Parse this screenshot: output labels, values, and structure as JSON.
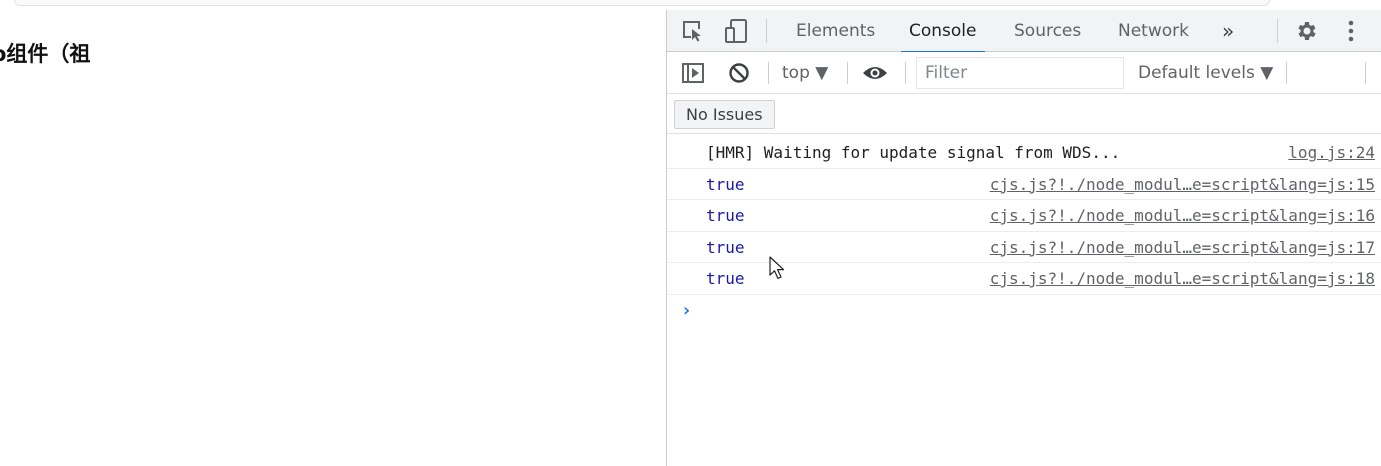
{
  "page": {
    "heading": "o组件（祖"
  },
  "devtools": {
    "tabs": [
      {
        "label": "Elements"
      },
      {
        "label": "Console"
      },
      {
        "label": "Sources"
      },
      {
        "label": "Network"
      }
    ],
    "more_tabs_glyph": "»",
    "toolbar": {
      "context": "top ▼",
      "filter_placeholder": "Filter",
      "levels": "Default levels ▼"
    },
    "issues_label": "No Issues",
    "console": {
      "messages": [
        {
          "text": "[HMR] Waiting for update signal from WDS...",
          "source": "log.js:24"
        },
        {
          "text": "true",
          "source": "cjs.js?!./node_modul…e=script&lang=js:15"
        },
        {
          "text": "true",
          "source": "cjs.js?!./node_modul…e=script&lang=js:16"
        },
        {
          "text": "true",
          "source": "cjs.js?!./node_modul…e=script&lang=js:17"
        },
        {
          "text": "true",
          "source": "cjs.js?!./node_modul…e=script&lang=js:18"
        }
      ],
      "prompt": "›"
    },
    "colors": {
      "accent": "#1a73e8",
      "boolean_value": "#1a1aa6",
      "panel_background": "#f1f3f4"
    },
    "icons": [
      "inspect-element-icon",
      "device-toolbar-icon",
      "settings-gear-icon",
      "kebab-menu-icon",
      "show-sidebar-icon",
      "clear-console-icon",
      "live-expression-eye-icon"
    ]
  }
}
